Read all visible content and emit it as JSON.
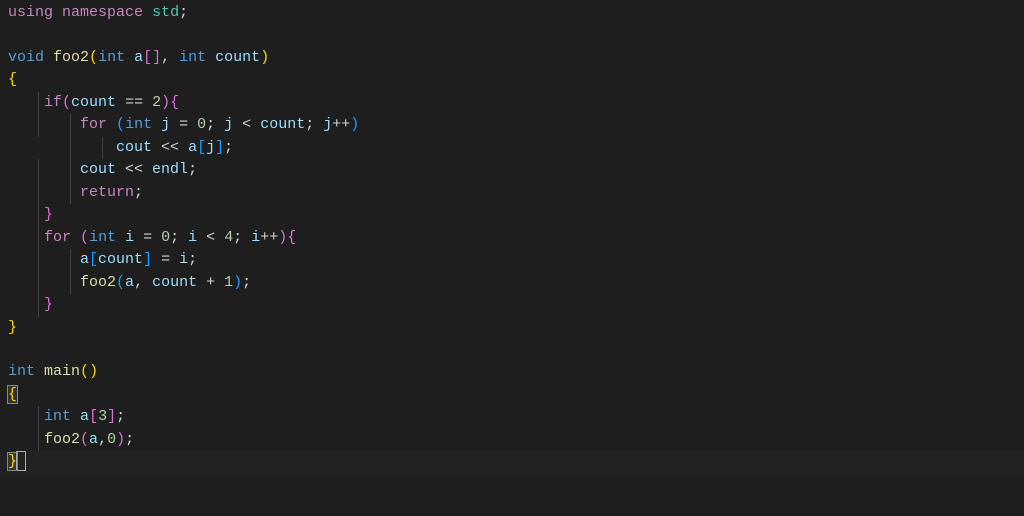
{
  "code": {
    "l1": {
      "using": "using",
      "namespace": "namespace",
      "std": "std",
      "semi": ";"
    },
    "l2": "",
    "l3": {
      "void": "void",
      "foo2": "foo2",
      "lparen": "(",
      "int1": "int",
      "a": "a",
      "brackets": "[]",
      "comma": ", ",
      "int2": "int",
      "count": "count",
      "rparen": ")"
    },
    "l4": "{",
    "l5": {
      "if": "if",
      "lparen": "(",
      "count": "count",
      "eq": " == ",
      "two": "2",
      "rparen": ")",
      "lbrace": "{"
    },
    "l6": {
      "for": "for",
      "lparen": "(",
      "int": "int",
      "j": "j",
      "eq": " = ",
      "zero": "0",
      "semi1": "; ",
      "j2": "j",
      "lt": " < ",
      "count": "count",
      "semi2": "; ",
      "j3": "j",
      "inc": "++",
      "rparen": ")"
    },
    "l7": {
      "cout": "cout",
      "ins": " << ",
      "a": "a",
      "lbracket": "[",
      "j": "j",
      "rbracket": "]",
      "semi": ";"
    },
    "l8": {
      "cout": "cout",
      "ins": " << ",
      "endl": "endl",
      "semi": ";"
    },
    "l9": {
      "return": "return",
      "semi": ";"
    },
    "l10": "}",
    "l11": {
      "for": "for",
      "lparen": "(",
      "int": "int",
      "i": "i",
      "eq": " = ",
      "zero": "0",
      "semi1": "; ",
      "i2": "i",
      "lt": " < ",
      "four": "4",
      "semi2": "; ",
      "i3": "i",
      "inc": "++",
      "rparen": ")",
      "lbrace": "{"
    },
    "l12": {
      "a": "a",
      "lbracket": "[",
      "count": "count",
      "rbracket": "]",
      "eq": " = ",
      "i": "i",
      "semi": ";"
    },
    "l13": {
      "foo2": "foo2",
      "lparen": "(",
      "a": "a",
      "comma": ", ",
      "count": "count",
      "plus": " + ",
      "one": "1",
      "rparen": ")",
      "semi": ";"
    },
    "l14": "}",
    "l15": "}",
    "l16": "",
    "l17": {
      "int": "int",
      "main": "main",
      "lparen": "(",
      "rparen": ")"
    },
    "l18": "{",
    "l19": {
      "int": "int",
      "a": "a",
      "lbracket": "[",
      "three": "3",
      "rbracket": "]",
      "semi": ";"
    },
    "l20": {
      "foo2": "foo2",
      "lparen": "(",
      "a": "a",
      "comma": ",",
      "zero": "0",
      "rparen": ")",
      "semi": ";"
    },
    "l21": "}"
  }
}
